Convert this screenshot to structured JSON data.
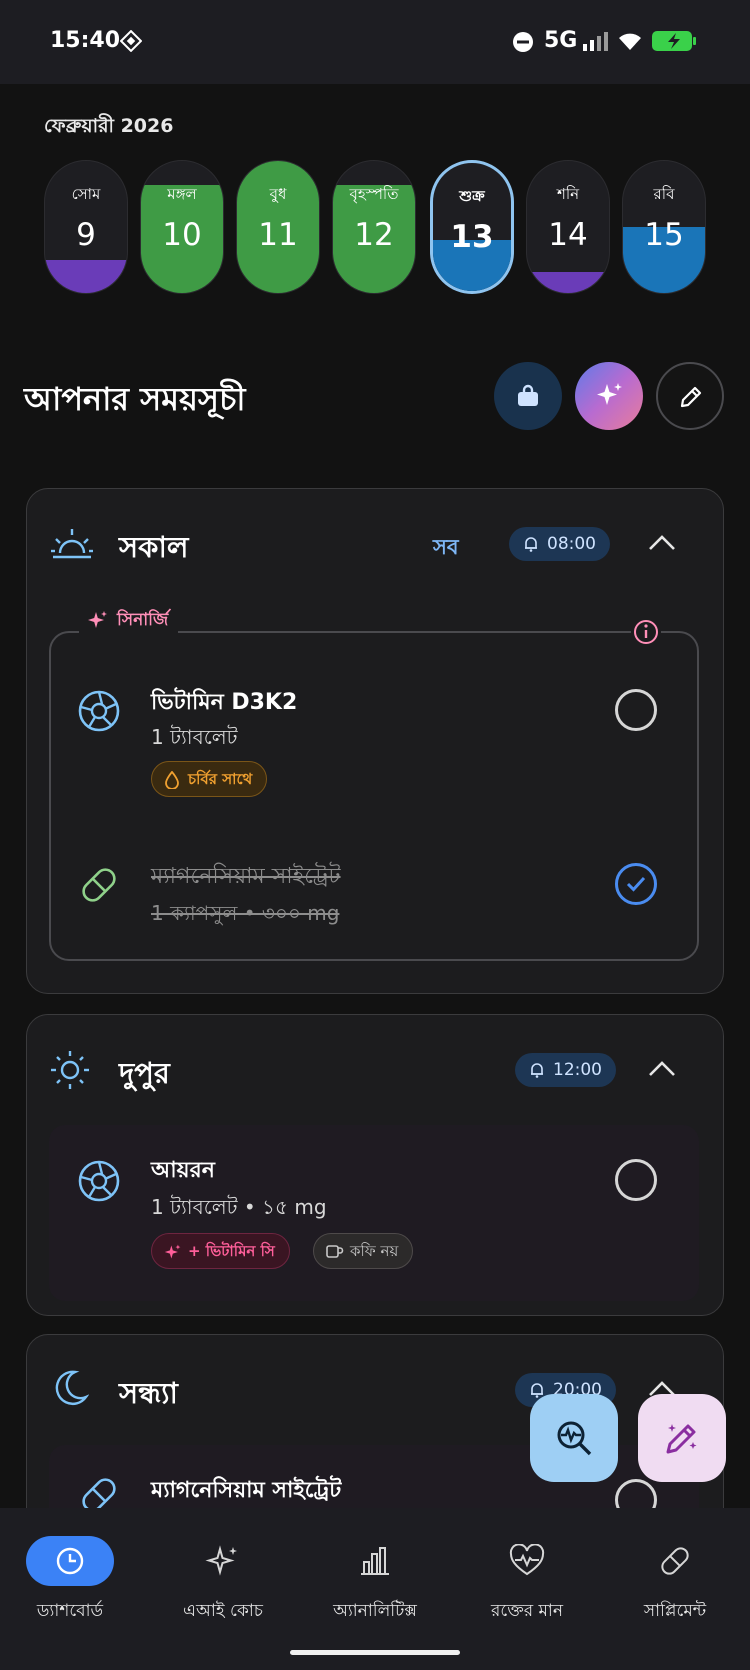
{
  "status_bar": {
    "time": "15:40",
    "network": "5G"
  },
  "calendar": {
    "month_label": "ফেব্রুয়ারী 2026",
    "days": [
      {
        "name": "সোম",
        "date": "9",
        "fill_color": "#6a3cb8",
        "fill_fraction": 0.25
      },
      {
        "name": "মঙ্গল",
        "date": "10",
        "fill_color": "#3f9b45",
        "fill_fraction": 0.82
      },
      {
        "name": "বুধ",
        "date": "11",
        "fill_color": "#3f9b45",
        "fill_fraction": 1.0
      },
      {
        "name": "বৃহস্পতি",
        "date": "12",
        "fill_color": "#3f9b45",
        "fill_fraction": 0.82
      },
      {
        "name": "শুক্র",
        "date": "13",
        "fill_color": "#1a75b8",
        "fill_fraction": 0.4,
        "selected": true
      },
      {
        "name": "শনি",
        "date": "14",
        "fill_color": "#6a3cb8",
        "fill_fraction": 0.16
      },
      {
        "name": "রবি",
        "date": "15",
        "fill_color": "#1a75b8",
        "fill_fraction": 0.5
      }
    ]
  },
  "schedule": {
    "title": "আপনার সময়সূচী",
    "sections": {
      "morning": {
        "title": "সকাল",
        "all_label": "সব",
        "time": "08:00",
        "synergy": {
          "label": "সিনার্জি",
          "items": [
            {
              "name": "ভিটামিন D3K2",
              "dose": "1 ট্যাবলেট",
              "chip": "চর্বির সাথে",
              "done": false
            },
            {
              "name": "ম্যাগনেসিয়াম সাইট্রেট",
              "dose": "1 ক্যাপসুল  •  ৩০০ mg",
              "done": true
            }
          ]
        }
      },
      "noon": {
        "title": "দুপুর",
        "time": "12:00",
        "items": [
          {
            "name": "আয়রন",
            "dose": "1 ট্যাবলেট  •  ১৫ mg",
            "chip_synergy": "+ ভিটামিন সি",
            "chip_avoid": "কফি নয়",
            "done": false
          }
        ]
      },
      "evening": {
        "title": "সন্ধ্যা",
        "time": "20:00",
        "items": [
          {
            "name": "ম্যাগনেসিয়াম সাইট্রেট"
          }
        ]
      }
    }
  },
  "nav": {
    "items": [
      {
        "label": "ড্যাশবোর্ড",
        "icon": "clock-icon",
        "active": true
      },
      {
        "label": "এআই কোচ",
        "icon": "sparkles-icon"
      },
      {
        "label": "অ্যানালিটিক্স",
        "icon": "bar-chart-icon"
      },
      {
        "label": "রক্তের মান",
        "icon": "heart-pulse-icon"
      },
      {
        "label": "সাপ্লিমেন্ট",
        "icon": "pill-icon"
      }
    ]
  },
  "colors": {
    "accent_blue": "#3b82f6",
    "green": "#3f9b45",
    "purple": "#6a3cb8",
    "blue": "#1a75b8",
    "orange": "#f0a030",
    "pink": "#ff5f9a"
  }
}
